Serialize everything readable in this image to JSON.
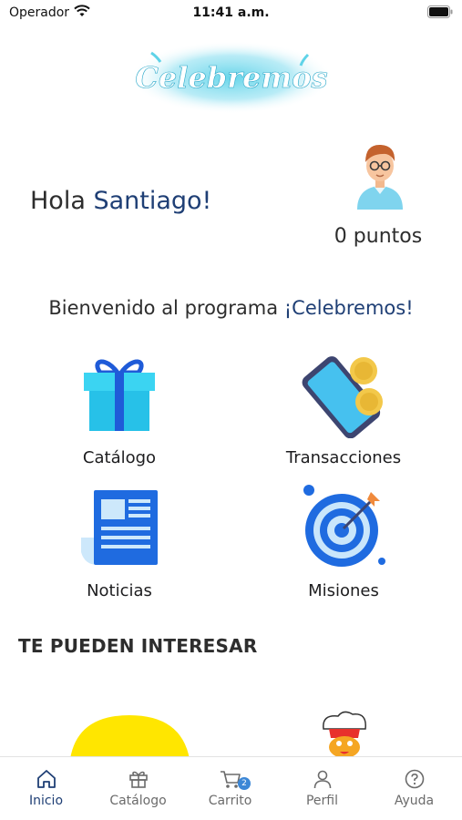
{
  "status_bar": {
    "carrier": "Operador",
    "time": "11:41 a.m."
  },
  "logo": {
    "text": "Celebremos"
  },
  "greeting": {
    "prefix": "Hola ",
    "name": "Santiago!"
  },
  "points": "0 puntos",
  "welcome": {
    "prefix": "Bienvenido al programa ",
    "brand": "¡Celebremos!"
  },
  "tiles": [
    {
      "label": "Catálogo",
      "icon": "gift-icon"
    },
    {
      "label": "Transacciones",
      "icon": "phone-coins-icon"
    },
    {
      "label": "Noticias",
      "icon": "newspaper-icon"
    },
    {
      "label": "Misiones",
      "icon": "target-icon"
    }
  ],
  "section_title": "TE PUEDEN INTERESAR",
  "tab_bar": {
    "tabs": [
      {
        "label": "Inicio",
        "icon": "home-icon",
        "active": true
      },
      {
        "label": "Catálogo",
        "icon": "gift-icon"
      },
      {
        "label": "Carrito",
        "icon": "cart-icon",
        "badge": "2"
      },
      {
        "label": "Perfil",
        "icon": "user-icon"
      },
      {
        "label": "Ayuda",
        "icon": "help-icon"
      }
    ]
  },
  "colors": {
    "brand_navy": "#1f3f75",
    "accent_blue": "#3c87d6",
    "logo_teal": "#5fd3e8"
  }
}
